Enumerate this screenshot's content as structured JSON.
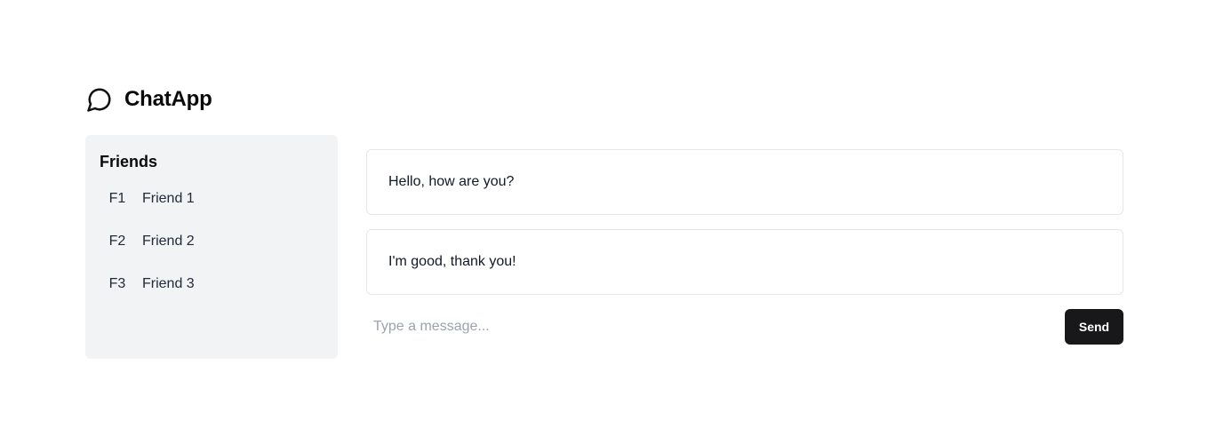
{
  "header": {
    "logo_icon": "message-circle-icon",
    "title": "ChatApp"
  },
  "sidebar": {
    "title": "Friends",
    "friends": [
      {
        "initials": "F1",
        "name": "Friend 1"
      },
      {
        "initials": "F2",
        "name": "Friend 2"
      },
      {
        "initials": "F3",
        "name": "Friend 3"
      }
    ]
  },
  "chat": {
    "messages": [
      {
        "text": "Hello, how are you?"
      },
      {
        "text": "I'm good, thank you!"
      }
    ],
    "composer": {
      "placeholder": "Type a message...",
      "value": "",
      "send_label": "Send"
    }
  },
  "colors": {
    "sidebar_bg": "#f2f3f5",
    "send_button_bg": "#18181b",
    "border": "#e5e7eb",
    "placeholder": "#9ca3af"
  }
}
